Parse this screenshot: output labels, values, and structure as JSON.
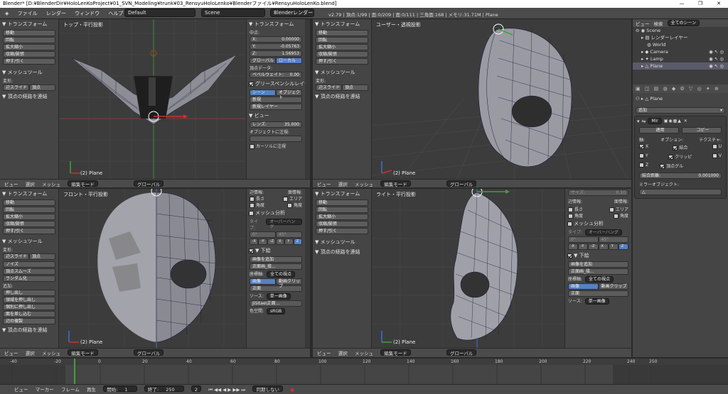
{
  "window": {
    "title": "Blender* [D:¥BlenderDir¥HoloLenKoProject¥01_SVN_Modeling¥trunk¥03_RensyuHoloLenko¥Blenderファイル¥RensyuHoloLenKo.blend]",
    "minimize": "—",
    "maximize": "❐",
    "close": "✕"
  },
  "topbar": {
    "menus": [
      "ファイル",
      "レンダー",
      "ウィンドウ",
      "ヘルプ"
    ],
    "layout": "Default",
    "scene": "Scene",
    "engine": "Blenderレンダー",
    "stats": "v2.79 | 頂点:1/99 | 面:0/209 | 面:0/111 | 三角面:168 | メモリ:31.71M | Plane"
  },
  "viewports": {
    "top": {
      "label": "トップ・平行投影",
      "object": "(2) Plane"
    },
    "user": {
      "label": "ユーザー・透視投影",
      "object": "(2) Plane"
    },
    "front": {
      "label": "フロント・平行投影",
      "object": "(2) Plane"
    },
    "right": {
      "label": "ライト・平行投影",
      "object": "(2) Plane"
    }
  },
  "toolshelf": {
    "transform_title": "▼ トランスフォーム",
    "transform_items": [
      "移動",
      "回転",
      "拡大縮小",
      "収縮/膨張",
      "押す/引く"
    ],
    "mesh_tools_title": "▼ メッシュツール",
    "deform_label": "変形:",
    "slide_edge": "辺スライド",
    "slide_vertex": "頂点",
    "noise": "ノイズ",
    "smooth_vertex": "頂点スムーズ",
    "randomize": "ランダム化",
    "add_label": "追加:",
    "extrude": "押し出し",
    "extrude_region": "領域を押し出し",
    "extrude_individual": "個別に押し出し",
    "subdivide": "面を差し込む",
    "duplicate": "辺の複製",
    "path_title": "▼ 頂点の経路を連結"
  },
  "props_top": {
    "transform_title": "▼ トランスフォーム",
    "median_label": "中点:",
    "x": {
      "label": "X:",
      "value": "0.00000"
    },
    "y": {
      "label": "Y:",
      "value": "-0.05763"
    },
    "z": {
      "label": "Z:",
      "value": "1.56953"
    },
    "global": "グローバル",
    "local": "ローカル",
    "vertex_data": "頂点データ:",
    "bevel_weight": {
      "label": "ベベルウェイト:",
      "value": "0.00"
    },
    "gp_title": "グリースペンシルレイヤー",
    "scene_btn": "シーン",
    "object_btn": "オブジェクト",
    "new_btn": "新規",
    "new_layer_btn": "新規レイヤー",
    "view_title": "▼ ビュー",
    "lens": {
      "label": "レンズ:",
      "value": "35.000"
    },
    "lock_object": "オブジェクトに注視:",
    "lock_cursor": "カーソルに注視"
  },
  "props_bottom": {
    "edge_label": "辺情報:",
    "face_label": "面情報:",
    "length": "長さ",
    "area": "エリア",
    "angle": "角度",
    "angle2": "角度",
    "mesh_analysis": "メッシュ分析",
    "type_label": "タイプ:",
    "type_value": "オーバーハング",
    "deg0": "0°",
    "deg45": "45°",
    "axes": [
      "-X",
      "-Y",
      "-Z",
      "X",
      "Y",
      "Z"
    ],
    "background_title": "▼ 下絵",
    "add_image": "画像を追加",
    "image_name": "正面画_接...",
    "axis_label": "座標軸:",
    "axis_value": "全ての視点",
    "image_btn": "画像",
    "movie_btn": "動画クリップ",
    "front_img": "正面",
    "source_label": "ソース:",
    "source_value": "単一画像",
    "file_name": "JiSitae\\正面...",
    "color_space_label": "色空間:",
    "color_space_value": "sRGB",
    "size_label": "サイズ:",
    "size_value": "0.10"
  },
  "headers": {
    "view": "ビュー",
    "select": "選択",
    "mesh": "メッシュ",
    "mode": "編集モード",
    "orientation": "グローバル"
  },
  "outliner": {
    "view": "ビュー",
    "search": "検索",
    "scenes": "全てのシーン",
    "rows": [
      "Scene",
      "レンダーレイヤー",
      "World",
      "Camera",
      "Lamp",
      "Plane"
    ]
  },
  "modifier": {
    "object_name": "Plane",
    "add_label": "追加",
    "mir_label": "Mir",
    "apply": "適用",
    "copy": "コピー",
    "axis_label": "軸:",
    "options_label": "オプション:",
    "texture_label": "テクスチャ:",
    "x": "X",
    "y": "Y",
    "z": "Z",
    "merge": "結合",
    "clipping": "クリッピ",
    "vertex_group": "頂点グル",
    "u": "U",
    "v": "V",
    "merge_dist_label": "結合距離:",
    "merge_dist": "0.001000",
    "mirror_obj": "ミラーオブジェクト:"
  },
  "timeline": {
    "ticks": [
      "-40",
      "-20",
      "0",
      "20",
      "40",
      "60",
      "80",
      "100",
      "120",
      "140",
      "160",
      "180",
      "200",
      "220",
      "240",
      "250"
    ],
    "view": "ビュー",
    "marker": "マーカー",
    "frame": "フレーム",
    "playback": "再生",
    "start_label": "開始:",
    "start": "1",
    "end_label": "終了:",
    "end": "250",
    "current": "2",
    "sync": "同期しない"
  }
}
